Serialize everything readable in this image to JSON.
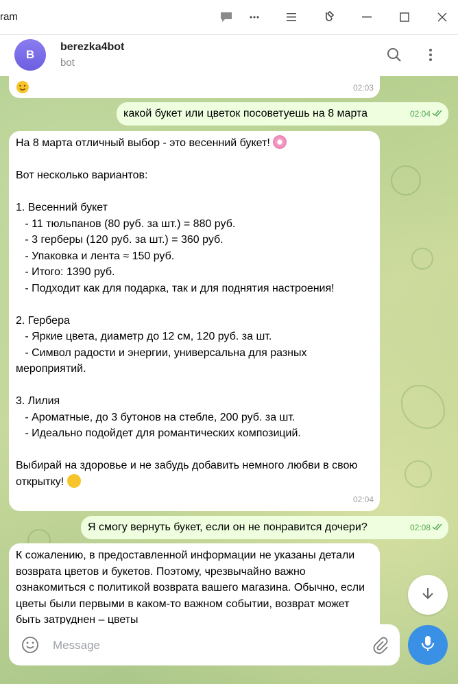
{
  "window": {
    "app_title": "ram",
    "minimize_symbol": "—",
    "maximize_symbol": "☐",
    "close_symbol": "✕",
    "icons": [
      "chat-bubble-icon",
      "more-dots-icon",
      "menu-lines-icon",
      "pin-settings-icon",
      "minimize-icon",
      "maximize-icon",
      "close-icon"
    ]
  },
  "header": {
    "avatar_letter": "B",
    "name": "berezka4bot",
    "status": "bot",
    "icons": [
      "search-icon",
      "kebab-menu-icon"
    ]
  },
  "messages": [
    {
      "side": "in",
      "text": "",
      "emoji": "winking-face",
      "time": "02:03"
    },
    {
      "side": "out",
      "text": "какой букет или цветок посоветуешь на 8 марта",
      "time": "02:04"
    },
    {
      "side": "in",
      "text": "На 8 марта отличный выбор - это весенний букет! ",
      "emoji": "cherry-blossom",
      "body": "Вот несколько вариантов:\n\n1. Весенний букет\n   - 11 тюльпанов (80 руб. за шт.) = 880 руб.\n   - 3 герберы (120 руб. за шт.) = 360 руб.\n   - Упаковка и лента ≈ 150 руб.\n   - Итого: 1390 руб.\n   - Подходит как для подарка, так и для поднятия настроения!\n\n2. Гербера\n   - Яркие цвета, диаметр до 12 см, 120 руб. за шт.\n   - Символ радости и энергии, универсальна для разных мероприятий.\n\n3. Лилия\n   - Ароматные, до 3 бутонов на стебле, 200 руб. за шт.\n   - Идеально подойдет для романтических композиций.\n\nВыбирай на здоровье и не забудь добавить немного любви в свою открытку! ",
      "emoji2": "smiling-face",
      "time": "02:04"
    },
    {
      "side": "out",
      "text": "Я смогу вернуть букет, если он не понравится дочери?",
      "time": "02:08"
    },
    {
      "side": "in",
      "text": "К сожалению, в предоставленной информации не указаны детали возврата цветов и букетов. Поэтому, чрезвычайно важно ознакомиться с политикой возврата вашего магазина. Обычно, если цветы были первыми в каком-то важном событии, возврат может быть затруднен – цветы",
      "time": ""
    }
  ],
  "composer": {
    "placeholder": "Message",
    "icons": [
      "emoji-icon",
      "attach-icon",
      "microphone-icon",
      "arrow-down-icon"
    ]
  },
  "colors": {
    "outgoing_bubble": "#eefedf",
    "incoming_bubble": "#ffffff",
    "accent": "#3a90e5",
    "check_color": "#55a852"
  }
}
